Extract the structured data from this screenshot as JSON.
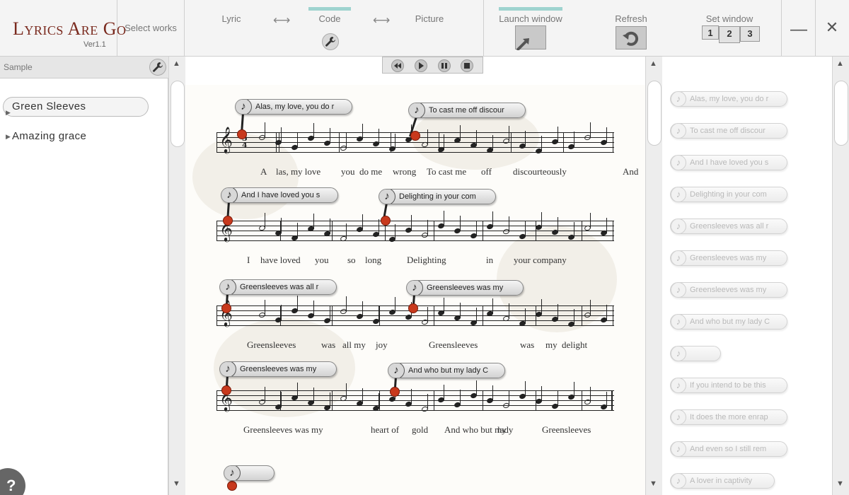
{
  "app": {
    "title": "Lyrics Are Go",
    "version": "Ver1.1"
  },
  "toolbar": {
    "select_works": "Select works",
    "modes": [
      "Lyric",
      "Code",
      "Picture"
    ],
    "active_mode": "Code",
    "arrow_glyph": "⟷",
    "launch_window": "Launch window",
    "refresh": "Refresh",
    "set_window": "Set window",
    "set_window_options": [
      "1",
      "2",
      "3"
    ],
    "minimize": "—",
    "close": "✕"
  },
  "left_panel": {
    "header": "Sample",
    "works": [
      "Green Sleeves",
      "Amazing grace"
    ],
    "selected_work": "Green Sleeves",
    "help": "?"
  },
  "score": {
    "lines": [
      {
        "lyrics": [
          "A",
          "las, my love",
          "you",
          "do me",
          "wrong",
          "To cast me",
          "off",
          "discourteously",
          "And"
        ],
        "cues": [
          "Alas, my love, you do r",
          "To cast me off discour"
        ]
      },
      {
        "lyrics": [
          "I",
          "have loved",
          "you",
          "so",
          "long",
          "Delighting",
          "in",
          "your company"
        ],
        "cues": [
          "And I have loved you s",
          "Delighting in your com"
        ]
      },
      {
        "lyrics": [
          "Greensleeves",
          "was",
          "all my",
          "joy",
          "Greensleeves",
          "was",
          "my",
          "delight"
        ],
        "cues": [
          "Greensleeves was all r",
          "Greensleeves was my"
        ]
      },
      {
        "lyrics": [
          "Greensleeves was my",
          "heart of",
          "gold",
          "And who but my",
          "lady",
          "Greensleeves"
        ],
        "cues": [
          "Greensleeves was my",
          "And who but my lady C"
        ]
      }
    ],
    "trailing_cue": ""
  },
  "right_panel": {
    "cues": [
      "Alas, my love, you do r",
      "To cast me off discour",
      "And I have loved you s",
      "Delighting in your com",
      "Greensleeves was all r",
      "Greensleeves was my",
      "Greensleeves was my",
      "And who but my lady C",
      "",
      "If you intend to be this",
      "It does the more enrap",
      "And even so I still rem",
      "A lover in captivity"
    ]
  },
  "icons": {
    "wrench": "wrench-icon",
    "note": "music-note-icon",
    "rewind": "rewind-icon",
    "play": "play-icon",
    "pause": "pause-icon",
    "stop": "stop-icon",
    "refresh": "refresh-icon",
    "launch": "launch-arrow-icon"
  },
  "colors": {
    "logo": "#7a2a1e",
    "active_tab": "#9ed3cf",
    "cue_dot": "#c8391d"
  }
}
